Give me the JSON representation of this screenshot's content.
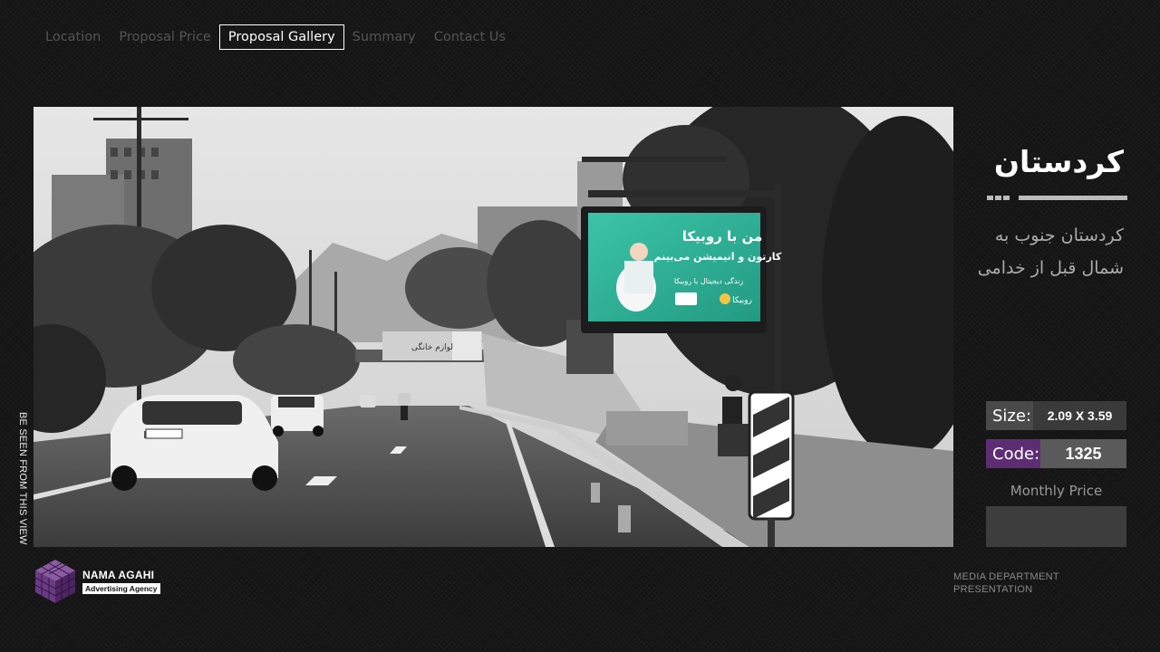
{
  "nav": {
    "items": [
      {
        "label": "Location",
        "active": false
      },
      {
        "label": "Proposal Price",
        "active": false
      },
      {
        "label": "Proposal Gallery",
        "active": true
      },
      {
        "label": "Summary",
        "active": false
      },
      {
        "label": "Contact Us",
        "active": false
      }
    ]
  },
  "photo": {
    "side_caption": "BE SEEN FROM THIS VIEW",
    "billboard": {
      "headline": "من با روبیکا",
      "subline": "کارتون و انیمیشن می‌بینم",
      "tagline": "زندگی دیجیتال با روبیکا",
      "brand": "روبیکا"
    },
    "bridge_banner": "لوازم خانگی"
  },
  "location": {
    "title": "کردستان",
    "description": "کردستان جنوب به شمال قبل از خدامی"
  },
  "specs": {
    "size_label": "Size:",
    "size_value": "2.09 X 3.59",
    "code_label": "Code:",
    "code_value": "1325",
    "monthly_label": "Monthly Price",
    "monthly_value": ""
  },
  "footer": {
    "brand_name": "NAMA AGAHI",
    "brand_sub": "Advertising Agency",
    "dept_line1": "MEDIA DEPARTMENT",
    "dept_line2": "PRESENTATION"
  },
  "colors": {
    "background": "#141414",
    "accent_purple": "#5d2d74",
    "billboard_teal": "#2db39a"
  }
}
